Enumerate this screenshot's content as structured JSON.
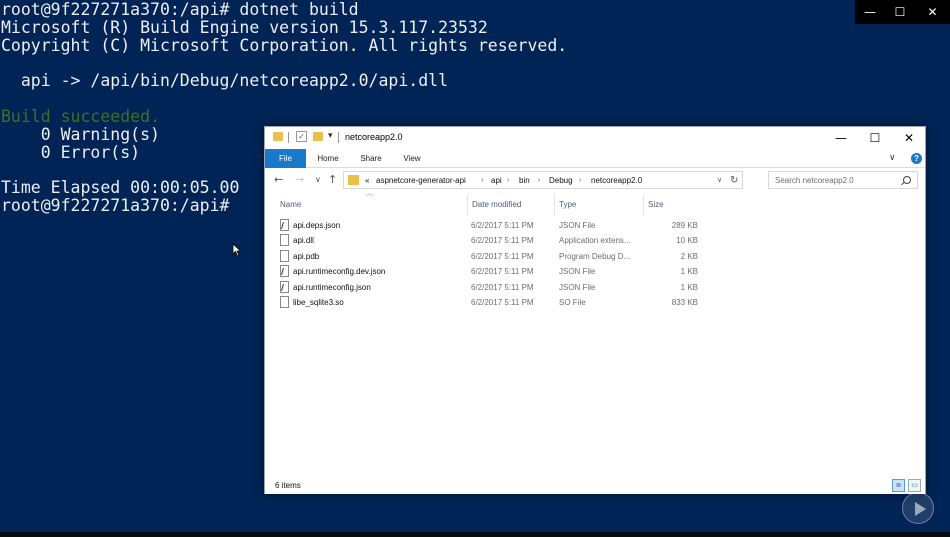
{
  "console": {
    "lines": [
      "root@9f227271a370:/api# dotnet build",
      "Microsoft (R) Build Engine version 15.3.117.23532",
      "Copyright (C) Microsoft Corporation. All rights reserved.",
      "",
      "  api -> /api/bin/Debug/netcoreapp2.0/api.dll",
      "",
      "Build succeeded.",
      "    0 Warning(s)",
      "    0 Error(s)",
      "",
      "Time Elapsed 00:00:05.00",
      "root@9f227271a370:/api#"
    ],
    "window_controls": {
      "minimize": "—",
      "maximize": "☐",
      "close": "✕"
    }
  },
  "explorer": {
    "title": "netcoreapp2.0",
    "title_controls": {
      "minimize": "—",
      "maximize": "☐",
      "close": "✕"
    },
    "ribbon_tabs": [
      "File",
      "Home",
      "Share",
      "View"
    ],
    "nav": {
      "back": "←",
      "forward": "→",
      "recent": "∨",
      "up": "↑"
    },
    "breadcrumb": [
      "«",
      "aspnetcore-generator-api",
      "api",
      "bin",
      "Debug",
      "netcoreapp2.0"
    ],
    "search_placeholder": "Search netcoreapp2.0",
    "columns": [
      "Name",
      "Date modified",
      "Type",
      "Size"
    ],
    "files": [
      {
        "name": "api.deps.json",
        "date": "6/2/2017 5:11 PM",
        "type": "JSON File",
        "size": "289 KB",
        "icon": "json-file-icon"
      },
      {
        "name": "api.dll",
        "date": "6/2/2017 5:11 PM",
        "type": "Application extens...",
        "size": "10 KB",
        "icon": "dll-file-icon"
      },
      {
        "name": "api.pdb",
        "date": "6/2/2017 5:11 PM",
        "type": "Program Debug D...",
        "size": "2 KB",
        "icon": "file-icon"
      },
      {
        "name": "api.runtimeconfig.dev.json",
        "date": "6/2/2017 5:11 PM",
        "type": "JSON File",
        "size": "1 KB",
        "icon": "json-file-icon"
      },
      {
        "name": "api.runtimeconfig.json",
        "date": "6/2/2017 5:11 PM",
        "type": "JSON File",
        "size": "1 KB",
        "icon": "json-file-icon"
      },
      {
        "name": "libe_sqlite3.so",
        "date": "6/2/2017 5:11 PM",
        "type": "SO File",
        "size": "833 KB",
        "icon": "file-icon"
      }
    ],
    "status": "6 items"
  },
  "colors": {
    "console_bg": "#012456",
    "console_text": "#eeedf0",
    "success_text": "#3f6f1f",
    "accent": "#1979ca"
  }
}
